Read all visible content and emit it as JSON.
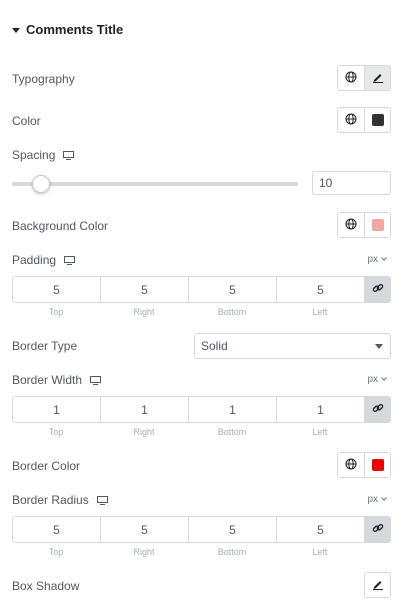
{
  "section": {
    "title": "Comments Title"
  },
  "typography": {
    "label": "Typography"
  },
  "color": {
    "label": "Color",
    "swatch": "#333333"
  },
  "spacing": {
    "label": "Spacing",
    "value": "10",
    "slider_fraction": 0.1
  },
  "background_color": {
    "label": "Background Color",
    "swatch": "#f4a6a6"
  },
  "padding": {
    "label": "Padding",
    "unit": "px",
    "values": [
      "5",
      "5",
      "5",
      "5"
    ],
    "labels": [
      "Top",
      "Right",
      "Bottom",
      "Left"
    ]
  },
  "border_type": {
    "label": "Border Type",
    "value": "Solid"
  },
  "border_width": {
    "label": "Border Width",
    "unit": "px",
    "values": [
      "1",
      "1",
      "1",
      "1"
    ],
    "labels": [
      "Top",
      "Right",
      "Bottom",
      "Left"
    ]
  },
  "border_color": {
    "label": "Border Color",
    "swatch": "#ee0000"
  },
  "border_radius": {
    "label": "Border Radius",
    "unit": "px",
    "values": [
      "5",
      "5",
      "5",
      "5"
    ],
    "labels": [
      "Top",
      "Right",
      "Bottom",
      "Left"
    ]
  },
  "box_shadow": {
    "label": "Box Shadow"
  },
  "icons": {
    "caret": "caret-down-icon",
    "globe": "globe-icon",
    "pencil": "pencil-icon",
    "monitor": "desktop-icon",
    "link": "link-icon"
  }
}
